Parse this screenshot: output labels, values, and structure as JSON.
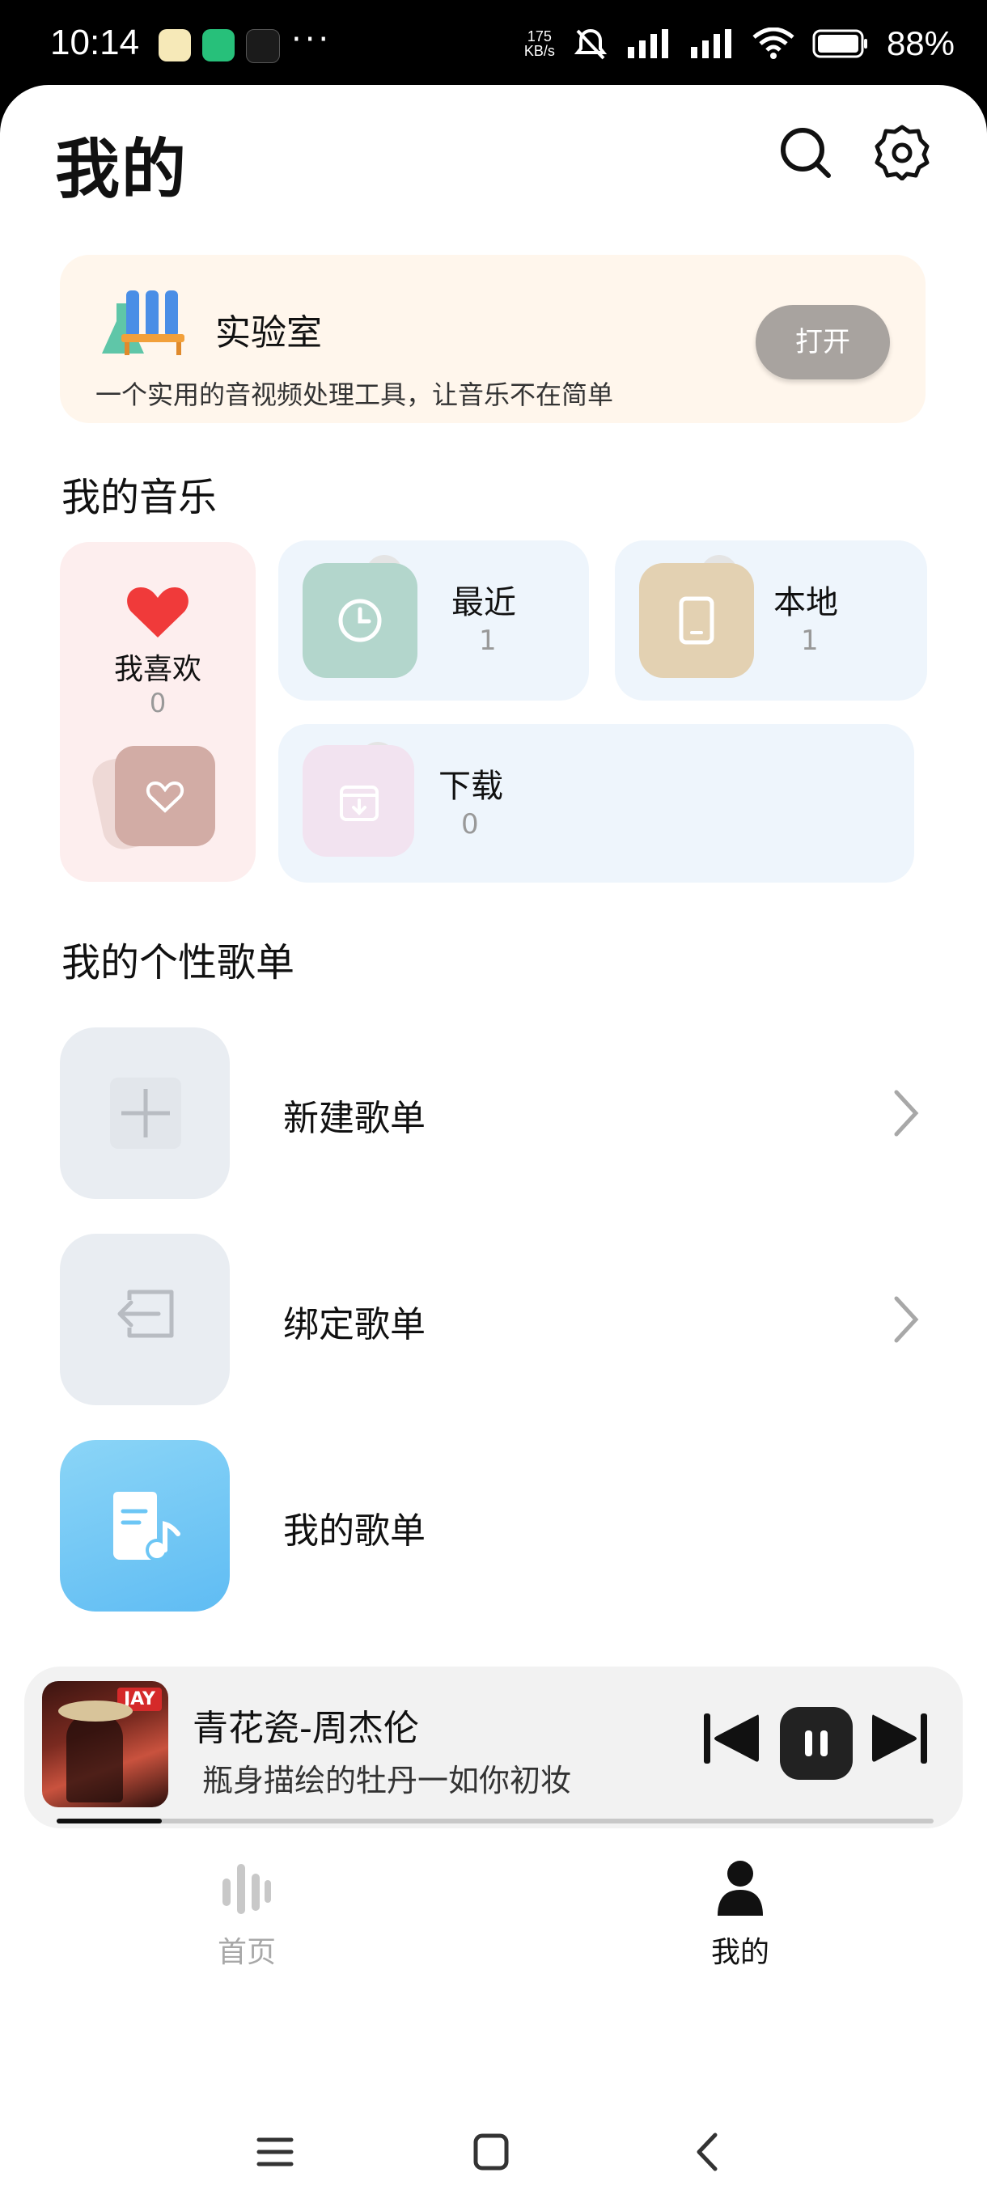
{
  "status_bar": {
    "time": "10:14",
    "more": "···",
    "net_speed_value": "175",
    "net_speed_unit": "KB/s",
    "battery": "88%"
  },
  "header": {
    "title": "我的"
  },
  "lab": {
    "title": "实验室",
    "description": "一个实用的音视频处理工具，让音乐不在简单",
    "open_label": "打开"
  },
  "my_music": {
    "title": "我的音乐",
    "favorites": {
      "label": "我喜欢",
      "count": "0"
    },
    "recent": {
      "label": "最近",
      "count": "1"
    },
    "local": {
      "label": "本地",
      "count": "1"
    },
    "downloads": {
      "label": "下载",
      "count": "0"
    }
  },
  "playlists": {
    "title": "我的个性歌单",
    "items": [
      {
        "label": "新建歌单"
      },
      {
        "label": "绑定歌单"
      },
      {
        "label": "我的歌单"
      }
    ]
  },
  "player": {
    "title": "青花瓷-周杰伦",
    "lyric": "瓶身描绘的牡丹一如你初妆",
    "cover_text": "JAY",
    "progress": 0.12
  },
  "tabs": [
    {
      "label": "首页",
      "active": false
    },
    {
      "label": "我的",
      "active": true
    }
  ],
  "colors": {
    "accent_red": "#f03a3a",
    "playlist_blue": "#6cc6f5",
    "lab_bg": "#fff6ec",
    "card_blue": "#eef5fc",
    "fav_bg": "#fdeeee"
  }
}
